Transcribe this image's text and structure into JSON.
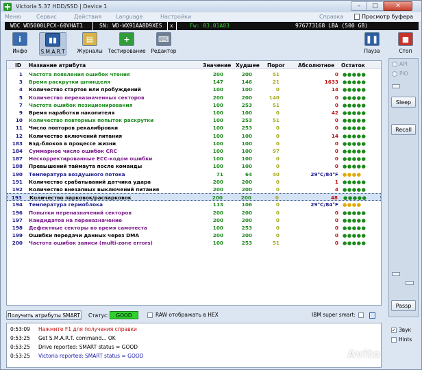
{
  "window": {
    "title": "Victoria 5.37 HDD/SSD | Device 1",
    "minimize": "–",
    "maximize": "□",
    "close": "✕"
  },
  "menu": {
    "items": [
      "Меню",
      "Сервис",
      "Действия",
      "Language",
      "Настройки",
      "Справка"
    ],
    "clipboard_viewer": "Просмотр буфера"
  },
  "device": {
    "model": "WDC WD5000LPCX-60VHAT1",
    "serial": "SN: WD-WX91AA8D9XES",
    "close_mark": "x",
    "firmware": "Fw: 03.01A03",
    "capacity": "976773168 LBA (500 GB)"
  },
  "toolbar": {
    "info": "Инфо",
    "smart": "S.M.A.R.T",
    "logs": "Журналы",
    "testing": "Тестирование",
    "editor": "Редактор",
    "pause": "Пауза",
    "stop": "Стоп"
  },
  "table": {
    "headers": {
      "id": "ID",
      "name": "Название атрибута",
      "value": "Значение",
      "worst": "Худшее",
      "threshold": "Порог",
      "raw": "Абсолютное",
      "health": "Остаток"
    },
    "rows": [
      {
        "id": "1",
        "name": "Частота появления ошибок чтения",
        "value": "200",
        "worst": "200",
        "threshold": "51",
        "raw": "0",
        "health": "●●●●●",
        "name_color": "#1d8a1d",
        "raw_color": "#c01010",
        "health_color": "#1d8a1d"
      },
      {
        "id": "3",
        "name": "Время раскрутки шпинделя",
        "value": "147",
        "worst": "146",
        "threshold": "21",
        "raw": "1633",
        "health": "●●●●●",
        "name_color": "#1d8a1d",
        "raw_color": "#c01010",
        "health_color": "#1d8a1d"
      },
      {
        "id": "4",
        "name": "Количество стартов или пробуждений",
        "value": "100",
        "worst": "100",
        "threshold": "0",
        "raw": "14",
        "health": "●●●●●",
        "name_color": "#000000",
        "raw_color": "#c01010",
        "health_color": "#1d8a1d"
      },
      {
        "id": "5",
        "name": "Количество переназначенных секторов",
        "value": "200",
        "worst": "200",
        "threshold": "140",
        "raw": "0",
        "health": "●●●●●",
        "name_color": "#7a1a8a",
        "raw_color": "#c01010",
        "health_color": "#1d8a1d"
      },
      {
        "id": "7",
        "name": "Частота ошибок позиционирования",
        "value": "100",
        "worst": "253",
        "threshold": "51",
        "raw": "0",
        "health": "●●●●●",
        "name_color": "#1d8a1d",
        "raw_color": "#c01010",
        "health_color": "#1d8a1d"
      },
      {
        "id": "9",
        "name": "Время наработки накопителя",
        "value": "100",
        "worst": "100",
        "threshold": "0",
        "raw": "42",
        "health": "●●●●●",
        "name_color": "#000000",
        "raw_color": "#c01010",
        "health_color": "#1d8a1d"
      },
      {
        "id": "10",
        "name": "Количество повторных попыток раскрутки",
        "value": "100",
        "worst": "253",
        "threshold": "51",
        "raw": "0",
        "health": "●●●●●",
        "name_color": "#1d8a1d",
        "raw_color": "#c01010",
        "health_color": "#1d8a1d"
      },
      {
        "id": "11",
        "name": "Число повторов рекалибровки",
        "value": "100",
        "worst": "253",
        "threshold": "0",
        "raw": "0",
        "health": "●●●●●",
        "name_color": "#000000",
        "raw_color": "#c01010",
        "health_color": "#1d8a1d"
      },
      {
        "id": "12",
        "name": "Количество включений питания",
        "value": "100",
        "worst": "100",
        "threshold": "0",
        "raw": "14",
        "health": "●●●●●",
        "name_color": "#000000",
        "raw_color": "#c01010",
        "health_color": "#1d8a1d"
      },
      {
        "id": "183",
        "name": "Бэд-блоков в процессе жизни",
        "value": "100",
        "worst": "100",
        "threshold": "0",
        "raw": "0",
        "health": "●●●●●",
        "name_color": "#000000",
        "raw_color": "#c01010",
        "health_color": "#1d8a1d"
      },
      {
        "id": "184",
        "name": "Суммарное число ошибок CRC",
        "value": "100",
        "worst": "100",
        "threshold": "97",
        "raw": "0",
        "health": "●●●●●",
        "name_color": "#7a1a8a",
        "raw_color": "#c01010",
        "health_color": "#1d8a1d"
      },
      {
        "id": "187",
        "name": "Нескорректированные ECC-кодом ошибки",
        "value": "100",
        "worst": "100",
        "threshold": "0",
        "raw": "0",
        "health": "●●●●●",
        "name_color": "#7a1a8a",
        "raw_color": "#c01010",
        "health_color": "#1d8a1d"
      },
      {
        "id": "188",
        "name": "Превышений таймаута после команды",
        "value": "100",
        "worst": "100",
        "threshold": "0",
        "raw": "0",
        "health": "●●●●●",
        "name_color": "#000000",
        "raw_color": "#c01010",
        "health_color": "#1d8a1d"
      },
      {
        "id": "190",
        "name": "Температура воздушного потока",
        "value": "71",
        "worst": "64",
        "threshold": "40",
        "raw": "29°C/84°F",
        "health": "●●●●",
        "name_color": "#1a1a8a",
        "raw_color": "#1a1a8a",
        "health_color": "#e0a800"
      },
      {
        "id": "191",
        "name": "Количество срабатываний датчика удара",
        "value": "200",
        "worst": "200",
        "threshold": "0",
        "raw": "1",
        "health": "●●●●●",
        "name_color": "#000000",
        "raw_color": "#c01010",
        "health_color": "#1d8a1d"
      },
      {
        "id": "192",
        "name": "Количество внезапных выключений питания",
        "value": "200",
        "worst": "200",
        "threshold": "0",
        "raw": "4",
        "health": "●●●●●",
        "name_color": "#000000",
        "raw_color": "#c01010",
        "health_color": "#1d8a1d"
      },
      {
        "id": "193",
        "name": "Количество парковок/распарковок",
        "value": "200",
        "worst": "200",
        "threshold": "0",
        "raw": "48",
        "health": "●●●●●",
        "name_color": "#000000",
        "raw_color": "#c01010",
        "health_color": "#1d8a1d"
      },
      {
        "id": "194",
        "name": "Температура гермоблока",
        "value": "113",
        "worst": "106",
        "threshold": "0",
        "raw": "29°C/84°F",
        "health": "●●●●",
        "name_color": "#1a1a8a",
        "raw_color": "#1a1a8a",
        "health_color": "#e0a800"
      },
      {
        "id": "196",
        "name": "Попытки переназначений секторов",
        "value": "200",
        "worst": "200",
        "threshold": "0",
        "raw": "0",
        "health": "●●●●●",
        "name_color": "#7a1a8a",
        "raw_color": "#c01010",
        "health_color": "#1d8a1d"
      },
      {
        "id": "197",
        "name": "Кандидатов на переназначение",
        "value": "200",
        "worst": "200",
        "threshold": "0",
        "raw": "0",
        "health": "●●●●●",
        "name_color": "#7a1a8a",
        "raw_color": "#c01010",
        "health_color": "#1d8a1d"
      },
      {
        "id": "198",
        "name": "Дефектные секторы во время самотеста",
        "value": "100",
        "worst": "253",
        "threshold": "0",
        "raw": "0",
        "health": "●●●●●",
        "name_color": "#7a1a8a",
        "raw_color": "#c01010",
        "health_color": "#1d8a1d"
      },
      {
        "id": "199",
        "name": "Ошибки передачи данных через DMA",
        "value": "200",
        "worst": "200",
        "threshold": "0",
        "raw": "0",
        "health": "●●●●●",
        "name_color": "#000000",
        "raw_color": "#c01010",
        "health_color": "#1d8a1d"
      },
      {
        "id": "200",
        "name": "Частота ошибок записи (multi-zone errors)",
        "value": "100",
        "worst": "253",
        "threshold": "51",
        "raw": "0",
        "health": "●●●●●",
        "name_color": "#7a1a8a",
        "raw_color": "#c01010",
        "health_color": "#1d8a1d"
      }
    ],
    "selected_row_id": "193"
  },
  "right_panel": {
    "api": "API",
    "pio": "PIO",
    "sleep": "Sleep",
    "recall": "Recall",
    "passp": "Passp"
  },
  "controls": {
    "get_attributes": "Получить атрибуты SMART",
    "status_label": "Статус:",
    "status_value": "GOOD",
    "raw_hex": "RAW отображать в HEX",
    "ibm_super_smart": "IBM super smart:"
  },
  "log": [
    {
      "time": "0:53:09",
      "message": "Нажмите F1 для получения справки",
      "color": "#c01010"
    },
    {
      "time": "0:53:25",
      "message": "Get S.M.A.R.T. command... OK",
      "color": "#000000"
    },
    {
      "time": "0:53:25",
      "message": "Drive reported: SMART status = GOOD",
      "color": "#000000"
    },
    {
      "time": "0:53:25",
      "message": "Victoria reported: SMART status = GOOD",
      "color": "#1a1aa8"
    }
  ],
  "log_panel": {
    "sound": "Звук",
    "hints": "Hints"
  },
  "watermark": "Avito"
}
